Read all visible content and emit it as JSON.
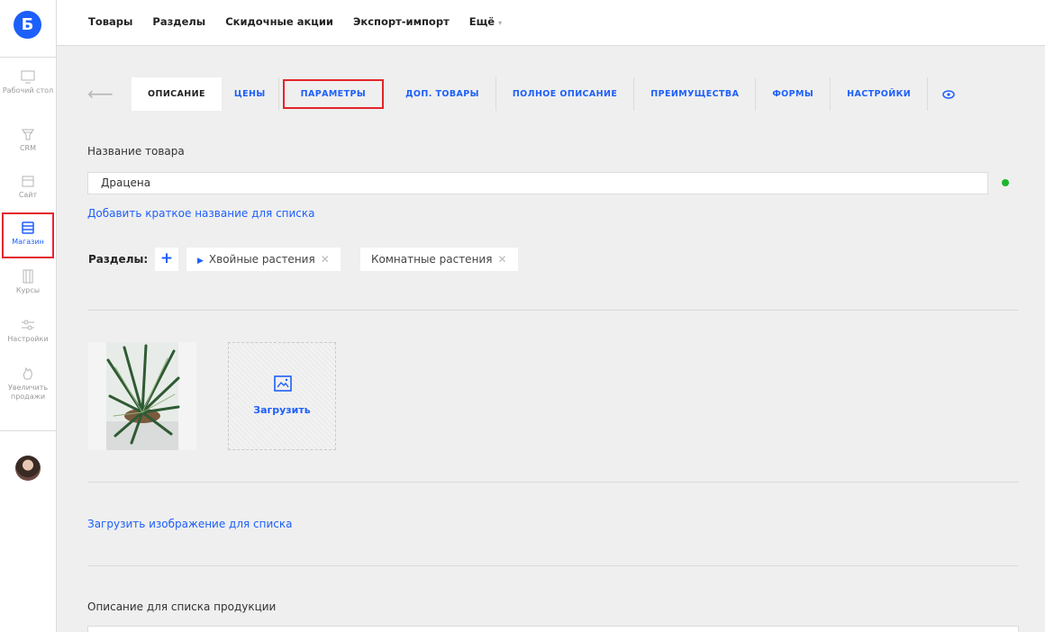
{
  "app": {
    "logo_letter": "Б",
    "brand_color": "#1d5ffb",
    "highlight_color": "#e3252b",
    "status_color": "#1db62b"
  },
  "rail": {
    "items": [
      {
        "label": "Рабочий стол",
        "icon": "desktop-icon"
      },
      {
        "label": "CRM",
        "icon": "funnel-icon"
      },
      {
        "label": "Сайт",
        "icon": "site-icon"
      },
      {
        "label": "Магазин",
        "icon": "store-icon"
      },
      {
        "label": "Курсы",
        "icon": "courses-icon"
      },
      {
        "label": "Настройки",
        "icon": "settings-sliders-icon"
      },
      {
        "label": "Увеличить продажи",
        "icon": "hand-icon"
      }
    ]
  },
  "topnav": {
    "items": [
      "Товары",
      "Разделы",
      "Скидочные акции",
      "Экспорт-импорт",
      "Ещё"
    ]
  },
  "tabs": {
    "items": [
      "ОПИСАНИЕ",
      "ЦЕНЫ",
      "ПАРАМЕТРЫ",
      "ДОП. ТОВАРЫ",
      "ПОЛНОЕ ОПИСАНИЕ",
      "ПРЕИМУЩЕСТВА",
      "ФОРМЫ",
      "НАСТРОЙКИ"
    ],
    "active_index": 0
  },
  "form": {
    "name_label": "Название товара",
    "name_value": "Драцена",
    "short_name_link": "Добавить краткое название для списка",
    "sections_label": "Разделы:",
    "sections": [
      "Хвойные растения",
      "Комнатные растения"
    ],
    "upload_label": "Загрузить",
    "list_image_link": "Загрузить изображение для списка",
    "list_description_label": "Описание для списка продукции"
  }
}
